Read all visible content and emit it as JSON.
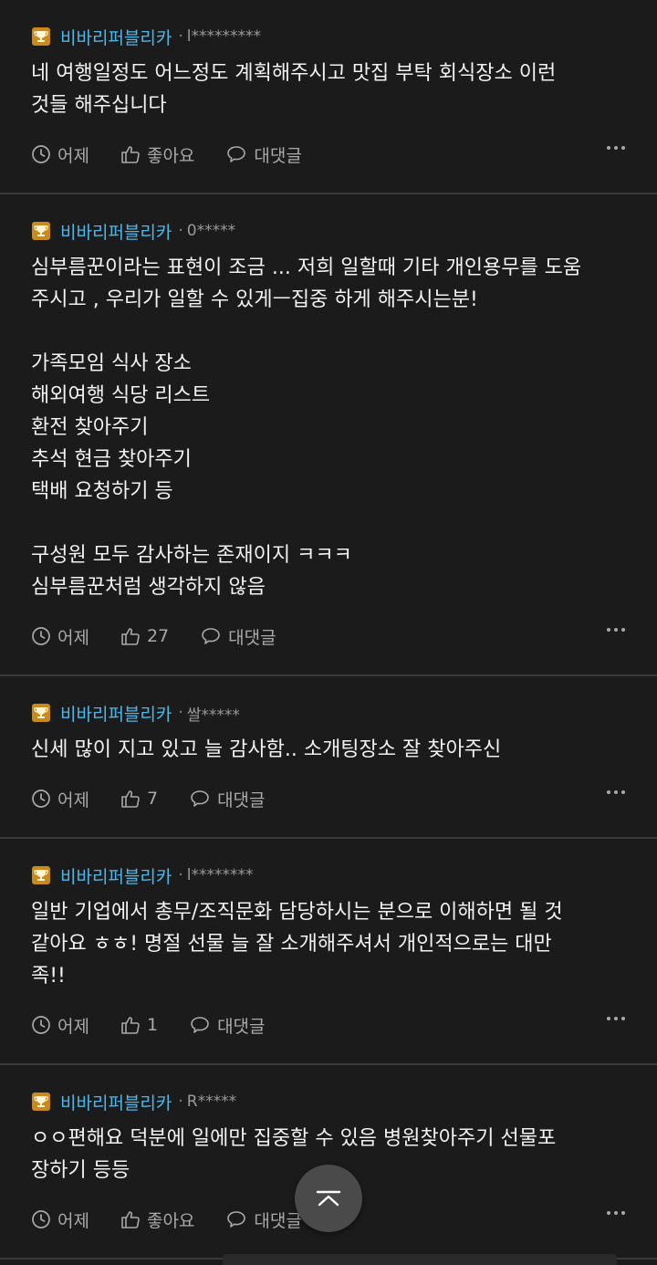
{
  "colors": {
    "background": "#1b1b1b",
    "company": "#4fb6e8",
    "text": "#f2f2f2",
    "muted": "#a9a9a9",
    "badge": "#c98a1a"
  },
  "comments": [
    {
      "company": "비바리퍼블리카",
      "author": "l*********",
      "body": "네 여행일정도 어느정도 계획해주시고 맛집 부탁 회식장소 이런\n것들 해주십니다",
      "time": "어제",
      "likes": "좋아요",
      "reply": "대댓글"
    },
    {
      "company": "비바리퍼블리카",
      "author": "0*****",
      "body": "심부름꾼이라는 표현이 조금 ... 저희 일할때 기타 개인용무를 도움\n주시고 , 우리가 일할 수 있게ㅡ집중 하게 해주시는분!\n\n가족모임 식사 장소\n해외여행 식당 리스트\n환전 찾아주기\n추석 현금 찾아주기\n택배 요청하기 등\n\n구성원 모두 감사하는 존재이지 ㅋㅋㅋ\n심부름꾼처럼 생각하지 않음",
      "time": "어제",
      "likes": "27",
      "reply": "대댓글"
    },
    {
      "company": "비바리퍼블리카",
      "author": "쌀*****",
      "body": "신세 많이 지고 있고 늘 감사함.. 소개팅장소 잘 찾아주신",
      "time": "어제",
      "likes": "7",
      "reply": "대댓글"
    },
    {
      "company": "비바리퍼블리카",
      "author": "l********",
      "body": "일반 기업에서 총무/조직문화 담당하시는 분으로 이해하면 될 것\n같아요 ㅎㅎ! 명절 선물 늘 잘 소개해주셔서 개인적으로는 대만\n족!!",
      "time": "어제",
      "likes": "1",
      "reply": "대댓글"
    },
    {
      "company": "비바리퍼블리카",
      "author": "R*****",
      "body": "ㅇㅇ편해요 덕분에 일에만 집중할 수 있음 병원찾아주기 선물포\n장하기 등등",
      "time": "어제",
      "likes": "좋아요",
      "reply": "대댓글"
    }
  ]
}
